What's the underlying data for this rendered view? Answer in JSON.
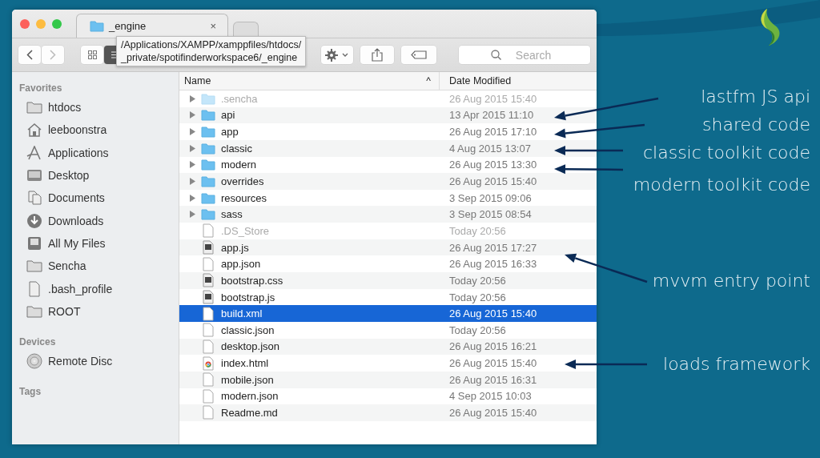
{
  "window": {
    "tabs": [
      {
        "label": "_engine",
        "close": "×",
        "selected": true
      },
      {
        "selected": false
      }
    ],
    "tooltip": "/Applications/XAMPP/xamppfiles/htdocs/\n_private/spotifinderworkspace6/_engine",
    "toolbar": {
      "views": [
        {
          "kind": "icons",
          "selected": false
        },
        {
          "kind": "list",
          "selected": true
        }
      ],
      "search": {
        "placeholder": "Search"
      }
    },
    "sidebar": [
      {
        "heading": "Favorites",
        "items": [
          {
            "label": "htdocs",
            "kind": "folder"
          },
          {
            "label": "leeboonstra",
            "kind": "home"
          },
          {
            "label": "Applications",
            "kind": "apps"
          },
          {
            "label": "Desktop",
            "kind": "desktop"
          },
          {
            "label": "Documents",
            "kind": "documents"
          },
          {
            "label": "Downloads",
            "kind": "downloads"
          },
          {
            "label": "All My Files",
            "kind": "allfiles"
          },
          {
            "label": "Sencha",
            "kind": "folder"
          },
          {
            "label": ".bash_profile",
            "kind": "file"
          },
          {
            "label": "ROOT",
            "kind": "folder"
          }
        ]
      },
      {
        "heading": "Devices",
        "items": [
          {
            "label": "Remote Disc",
            "kind": "disc"
          }
        ]
      },
      {
        "heading": "Tags"
      }
    ],
    "table": {
      "columns": [
        {
          "label": "Name",
          "sort": "^"
        },
        {
          "label": "Date Modified"
        }
      ],
      "rows": [
        {
          "name": ".sencha",
          "date": "26 Aug 2015 15:40",
          "kind": "folder",
          "hidden": true,
          "selected": false
        },
        {
          "name": "api",
          "date": "13 Apr 2015 11:10",
          "kind": "folder",
          "hidden": false,
          "selected": false
        },
        {
          "name": "app",
          "date": "26 Aug 2015 17:10",
          "kind": "folder",
          "hidden": false,
          "selected": false
        },
        {
          "name": "classic",
          "date": "4 Aug 2015 13:07",
          "kind": "folder",
          "hidden": false,
          "selected": false
        },
        {
          "name": "modern",
          "date": "26 Aug 2015 13:30",
          "kind": "folder",
          "hidden": false,
          "selected": false
        },
        {
          "name": "overrides",
          "date": "26 Aug 2015 15:40",
          "kind": "folder",
          "hidden": false,
          "selected": false
        },
        {
          "name": "resources",
          "date": "3 Sep 2015 09:06",
          "kind": "folder",
          "hidden": false,
          "selected": false
        },
        {
          "name": "sass",
          "date": "3 Sep 2015 08:54",
          "kind": "folder",
          "hidden": false,
          "selected": false
        },
        {
          "name": ".DS_Store",
          "date": "Today 20:56",
          "kind": "file",
          "hidden": true,
          "selected": false
        },
        {
          "name": "app.js",
          "date": "26 Aug 2015 17:27",
          "kind": "script",
          "hidden": false,
          "selected": false
        },
        {
          "name": "app.json",
          "date": "26 Aug 2015 16:33",
          "kind": "file",
          "hidden": false,
          "selected": false
        },
        {
          "name": "bootstrap.css",
          "date": "Today 20:56",
          "kind": "script",
          "hidden": false,
          "selected": false
        },
        {
          "name": "bootstrap.js",
          "date": "Today 20:56",
          "kind": "script",
          "hidden": false,
          "selected": false
        },
        {
          "name": "build.xml",
          "date": "26 Aug 2015 15:40",
          "kind": "file",
          "hidden": false,
          "selected": true
        },
        {
          "name": "classic.json",
          "date": "Today 20:56",
          "kind": "file",
          "hidden": false,
          "selected": false
        },
        {
          "name": "desktop.json",
          "date": "26 Aug 2015 16:21",
          "kind": "file",
          "hidden": false,
          "selected": false
        },
        {
          "name": "index.html",
          "date": "26 Aug 2015 15:40",
          "kind": "browser",
          "hidden": false,
          "selected": false
        },
        {
          "name": "mobile.json",
          "date": "26 Aug 2015 16:31",
          "kind": "file",
          "hidden": false,
          "selected": false
        },
        {
          "name": "modern.json",
          "date": "4 Sep 2015 10:03",
          "kind": "file",
          "hidden": false,
          "selected": false
        },
        {
          "name": "Readme.md",
          "date": "26 Aug 2015 15:40",
          "kind": "file",
          "hidden": false,
          "selected": false
        }
      ]
    }
  },
  "annotations": [
    "lastfm JS api",
    "shared code",
    "classic toolkit code",
    "modern toolkit code",
    "mvvm entry point",
    "loads framework"
  ]
}
